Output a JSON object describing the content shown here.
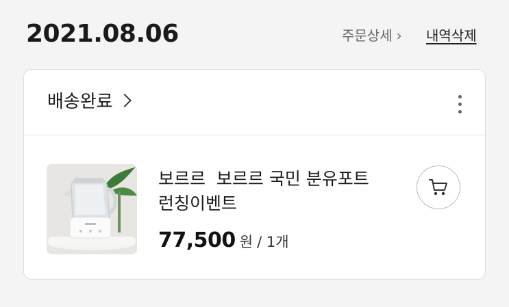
{
  "order": {
    "date": "2021.08.06",
    "detail_link": "주문상세",
    "detail_chevron": "›",
    "delete_link": "내역삭제"
  },
  "card": {
    "status": "배송완료",
    "more_icon": "more-vertical-icon",
    "item": {
      "name": "보르르  보르르 국민 분유포트\n런칭이벤트",
      "price": "77,500",
      "price_unit": "원",
      "quantity": "/ 1개",
      "cart_icon": "cart-icon"
    }
  },
  "colors": {
    "background": "#f5f4f4",
    "card": "#ffffff",
    "text": "#111111",
    "muted": "#666666"
  }
}
